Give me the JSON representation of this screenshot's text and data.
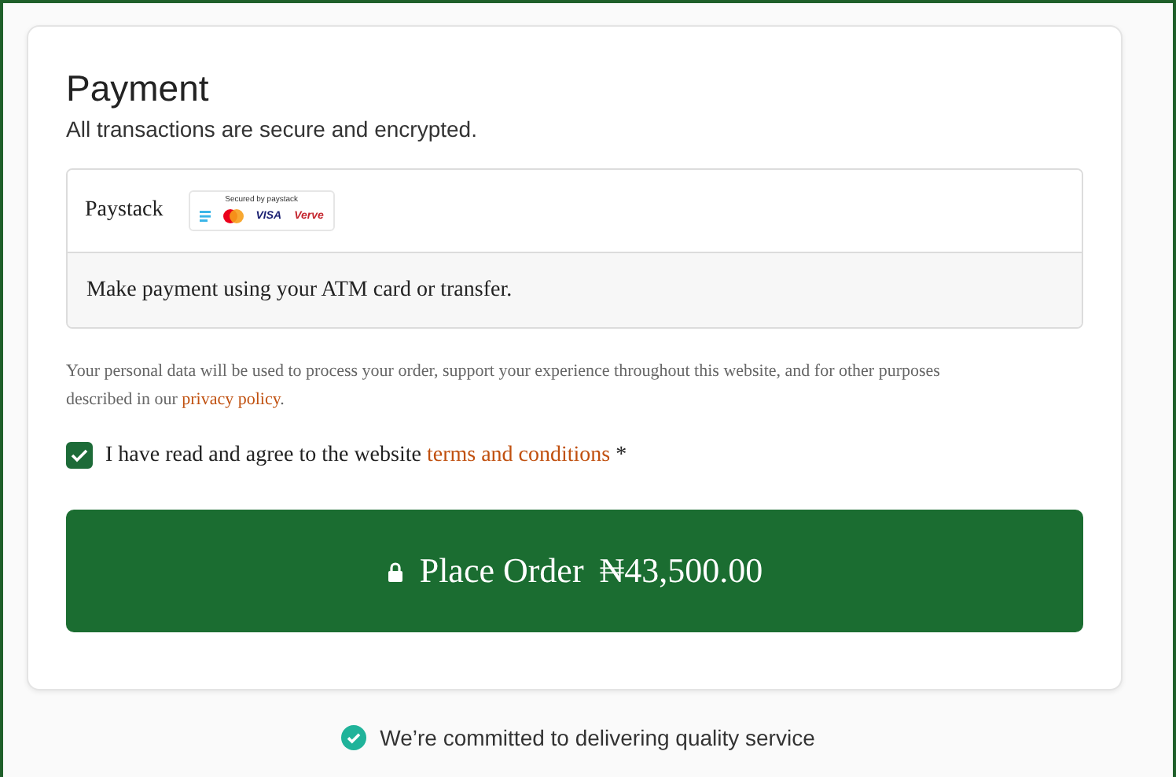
{
  "payment": {
    "title": "Payment",
    "subtitle": "All transactions are secure and encrypted.",
    "method": {
      "name": "Paystack",
      "badge_caption": "Secured by paystack",
      "cards": [
        "VISA",
        "Verve"
      ],
      "description": "Make payment using your ATM card or transfer."
    },
    "privacy": {
      "before": "Your personal data will be used to process your order, support your experience throughout this website, and for other purposes described in our ",
      "link": "privacy policy",
      "after": "."
    },
    "terms": {
      "checked": true,
      "before": "I have read and agree to the website ",
      "link": "terms and conditions",
      "required": "*"
    },
    "order_button": {
      "label": "Place Order",
      "amount": "₦43,500.00"
    }
  },
  "footer": {
    "text": "We’re committed to delivering quality service"
  }
}
